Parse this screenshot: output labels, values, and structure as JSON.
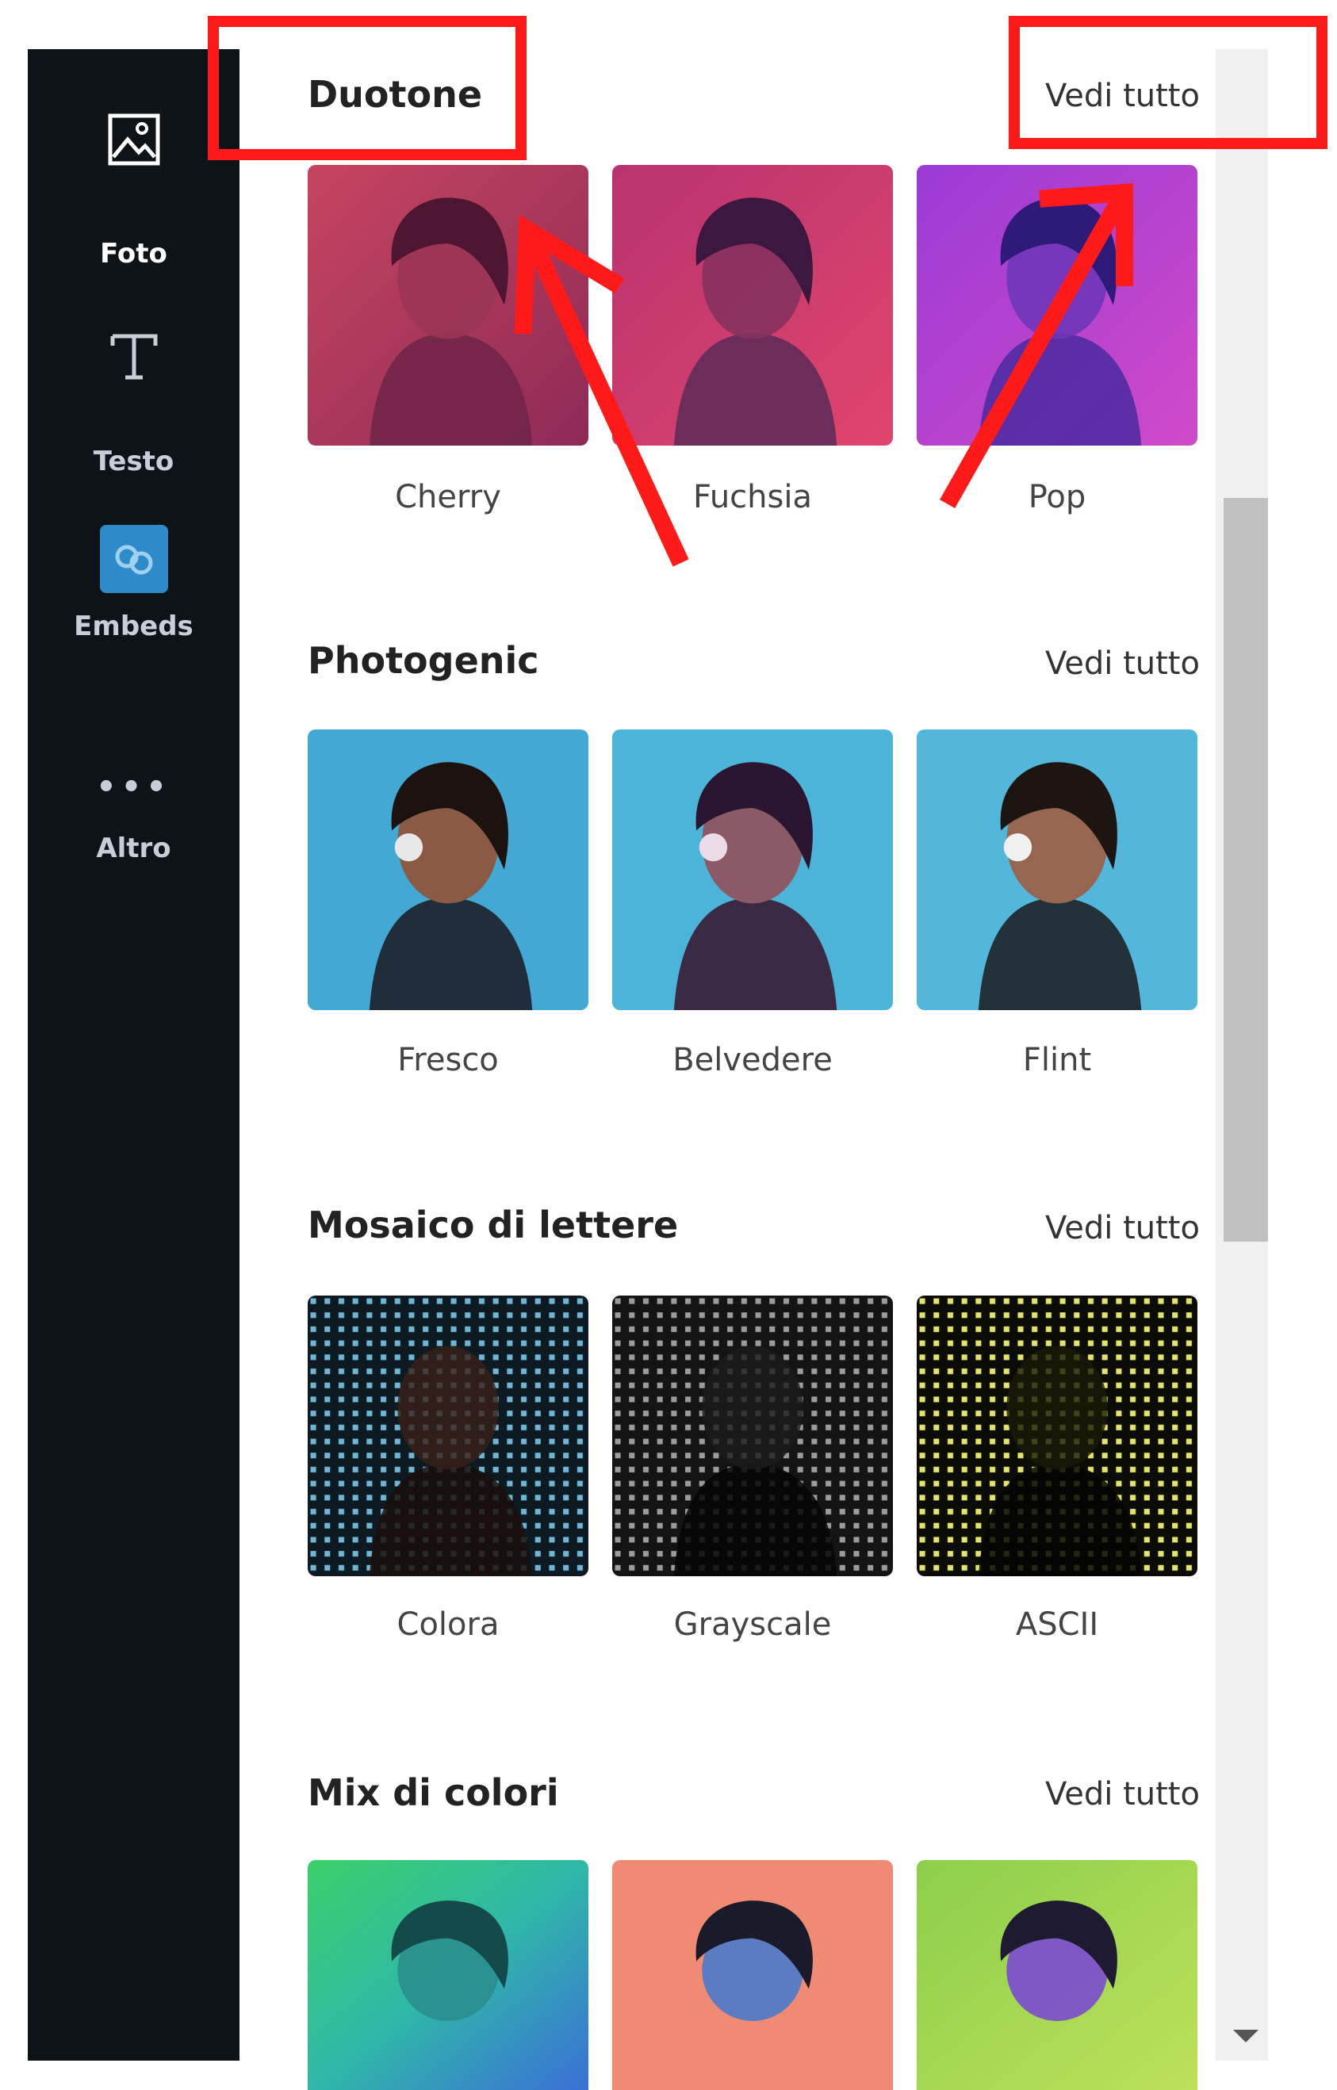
{
  "sidebar": {
    "items": [
      {
        "label": "Foto",
        "icon": "image-icon",
        "active": true
      },
      {
        "label": "Testo",
        "icon": "text-icon",
        "active": false
      },
      {
        "label": "Embeds",
        "icon": "embeds-icon",
        "active": false
      },
      {
        "label": "Altro",
        "icon": "more-dots-icon",
        "active": false
      }
    ]
  },
  "sections": [
    {
      "title": "Duotone",
      "see_all": "Vedi tutto",
      "items": [
        {
          "label": "Cherry"
        },
        {
          "label": "Fuchsia"
        },
        {
          "label": "Pop"
        }
      ]
    },
    {
      "title": "Photogenic",
      "see_all": "Vedi tutto",
      "items": [
        {
          "label": "Fresco"
        },
        {
          "label": "Belvedere"
        },
        {
          "label": "Flint"
        }
      ]
    },
    {
      "title": "Mosaico di lettere",
      "see_all": "Vedi tutto",
      "items": [
        {
          "label": "Colora"
        },
        {
          "label": "Grayscale"
        },
        {
          "label": "ASCII"
        }
      ]
    },
    {
      "title": "Mix di colori",
      "see_all": "Vedi tutto",
      "items": [
        {
          "label": ""
        },
        {
          "label": ""
        },
        {
          "label": ""
        }
      ]
    }
  ],
  "colors": {
    "sidebar_bg": "#0e1318",
    "annotation": "#ff1a1a",
    "embeds_tile": "#2f8ac9"
  }
}
